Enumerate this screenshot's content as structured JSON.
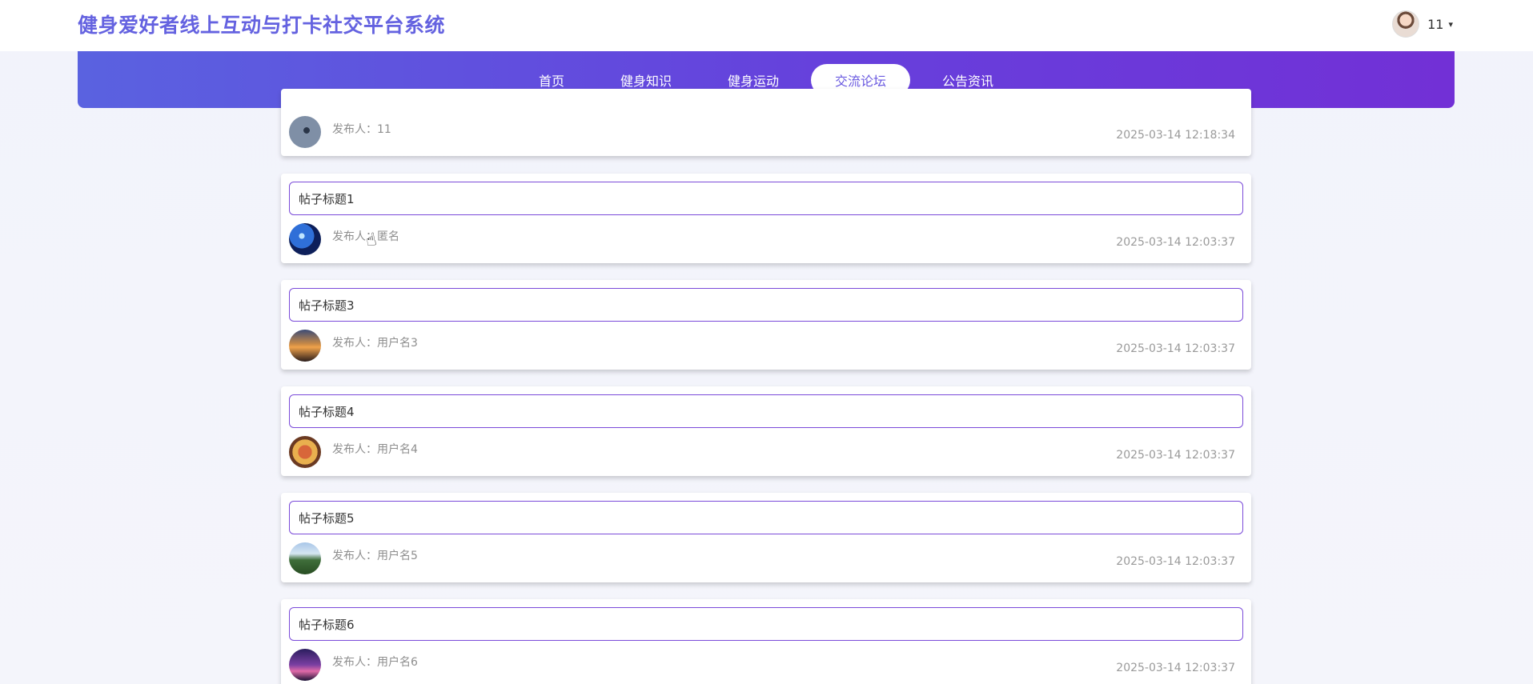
{
  "header": {
    "site_title": "健身爱好者线上互动与打卡社交平台系统",
    "user_name": "11",
    "caret": "▾"
  },
  "nav": {
    "items": [
      {
        "label": "首页",
        "active": false
      },
      {
        "label": "健身知识",
        "active": false
      },
      {
        "label": "健身运动",
        "active": false
      },
      {
        "label": "交流论坛",
        "active": true
      },
      {
        "label": "公告资讯",
        "active": false
      }
    ]
  },
  "posts": [
    {
      "title": "",
      "author": "发布人：11",
      "time": "2025-03-14 12:18:34",
      "avatar_icon": "avatar-icon"
    },
    {
      "title": "帖子标题1",
      "author": "发布人：匿名",
      "time": "2025-03-14 12:03:37",
      "avatar_icon": "avatar-icon"
    },
    {
      "title": "帖子标题3",
      "author": "发布人：用户名3",
      "time": "2025-03-14 12:03:37",
      "avatar_icon": "avatar-icon"
    },
    {
      "title": "帖子标题4",
      "author": "发布人：用户名4",
      "time": "2025-03-14 12:03:37",
      "avatar_icon": "avatar-icon"
    },
    {
      "title": "帖子标题5",
      "author": "发布人：用户名5",
      "time": "2025-03-14 12:03:37",
      "avatar_icon": "avatar-icon"
    },
    {
      "title": "帖子标题6",
      "author": "发布人：用户名6",
      "time": "2025-03-14 12:03:37",
      "avatar_icon": "avatar-icon"
    }
  ],
  "colors": {
    "brand": "#6462e0",
    "nav_gradient_start": "#5a62e0",
    "nav_gradient_end": "#7230d6",
    "title_border": "#7a4ad9"
  }
}
